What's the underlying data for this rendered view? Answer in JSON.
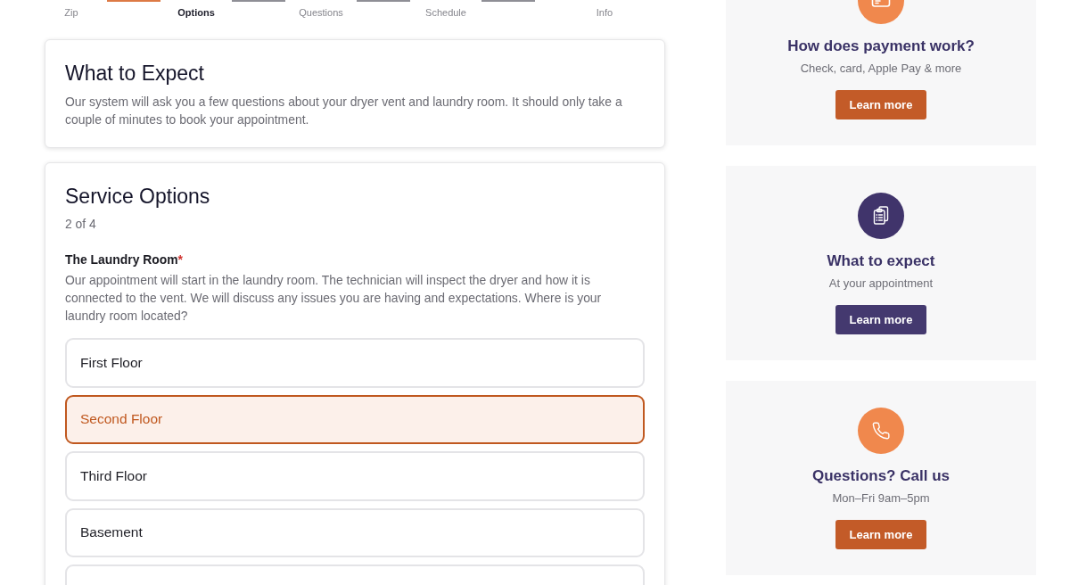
{
  "stepper": {
    "steps": [
      {
        "label": "Zip",
        "selected": false
      },
      {
        "label": "Options",
        "selected": true
      },
      {
        "label": "Questions",
        "selected": false
      },
      {
        "label": "Schedule",
        "selected": false
      },
      {
        "label": "Info",
        "selected": false
      }
    ]
  },
  "intro_card": {
    "title": "What to Expect",
    "text": "Our system will ask you a few questions about your dryer vent and laundry room. It should only take a couple of minutes to book your appointment."
  },
  "service_options": {
    "title": "Service Options",
    "progress": "2 of 4",
    "question": {
      "label": "The Laundry Room",
      "required_mark": "*",
      "description": "Our appointment will start in the laundry room. The technician will inspect the dryer and how it is connected to the vent. We will discuss any issues you are having and expectations. Where is your laundry room located?",
      "options": [
        {
          "label": "First Floor",
          "selected": false
        },
        {
          "label": "Second Floor",
          "selected": true
        },
        {
          "label": "Third Floor",
          "selected": false
        },
        {
          "label": "Basement",
          "selected": false
        },
        {
          "selected": false
        }
      ]
    }
  },
  "info_cards": [
    {
      "kind": "payment",
      "color": "#f0884d",
      "title": "How does payment work?",
      "subtitle": "Check, card, Apple Pay & more",
      "button": {
        "label": "Learn more",
        "color": "#c35b28"
      }
    },
    {
      "kind": "expectations",
      "color": "#40346b",
      "title": "What to expect",
      "subtitle": "At your appointment",
      "button": {
        "label": "Learn more",
        "color": "#44396f"
      }
    },
    {
      "kind": "contact",
      "color": "#f0884d",
      "title": "Questions? Call us",
      "subtitle": "Mon–Fri 9am–5pm",
      "button": {
        "label": "Learn more",
        "color": "#c35b28"
      }
    }
  ]
}
